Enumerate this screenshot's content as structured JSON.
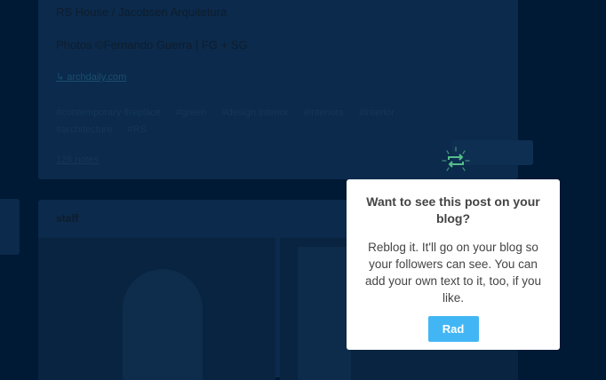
{
  "post": {
    "title": "RS House / Jacobsen Arquitetura",
    "credit": "Photos ©Fernando Guerra | FG + SG",
    "link": "↳ archdaily.com",
    "tags": [
      "#contemporary fireplace",
      "#green",
      "#design interior",
      "#interiors",
      "#interior",
      "#architecture",
      "#RS"
    ],
    "notes": "126 notes"
  },
  "second_post": {
    "author": "staff"
  },
  "popover": {
    "title": "Want to see this post on your blog?",
    "body": "Reblog it. It'll go on your blog so your followers can see. You can add your own text to it, too, if you like.",
    "button_label": "Rad"
  },
  "colors": {
    "background": "#001935",
    "accent": "#42b6f4",
    "reblog": "#56bc8a"
  },
  "icons": [
    "reblog-icon"
  ]
}
